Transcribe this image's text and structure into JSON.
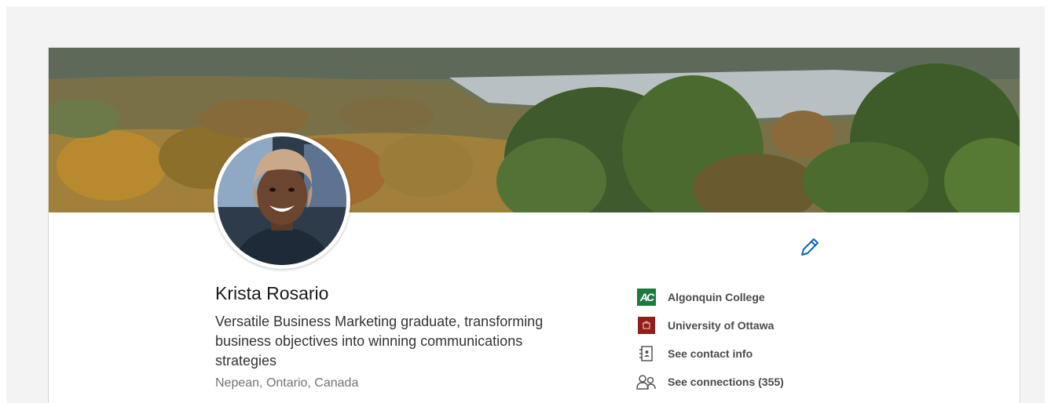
{
  "profile": {
    "name": "Krista Rosario",
    "headline": "Versatile Business Marketing graduate, transforming business objectives into winning communications strategies",
    "location": "Nepean, Ontario, Canada"
  },
  "sidebar": {
    "items": [
      {
        "label": "Algonquin College",
        "icon": "algonquin-college-logo"
      },
      {
        "label": "University of Ottawa",
        "icon": "university-of-ottawa-logo"
      },
      {
        "label": "See contact info",
        "icon": "contact-card-icon"
      },
      {
        "label": "See connections (355)",
        "icon": "connections-icon"
      }
    ]
  },
  "colors": {
    "accent": "#0a66c2",
    "algonquin": "#1d7a3e",
    "uottawa": "#8f1f1b"
  }
}
